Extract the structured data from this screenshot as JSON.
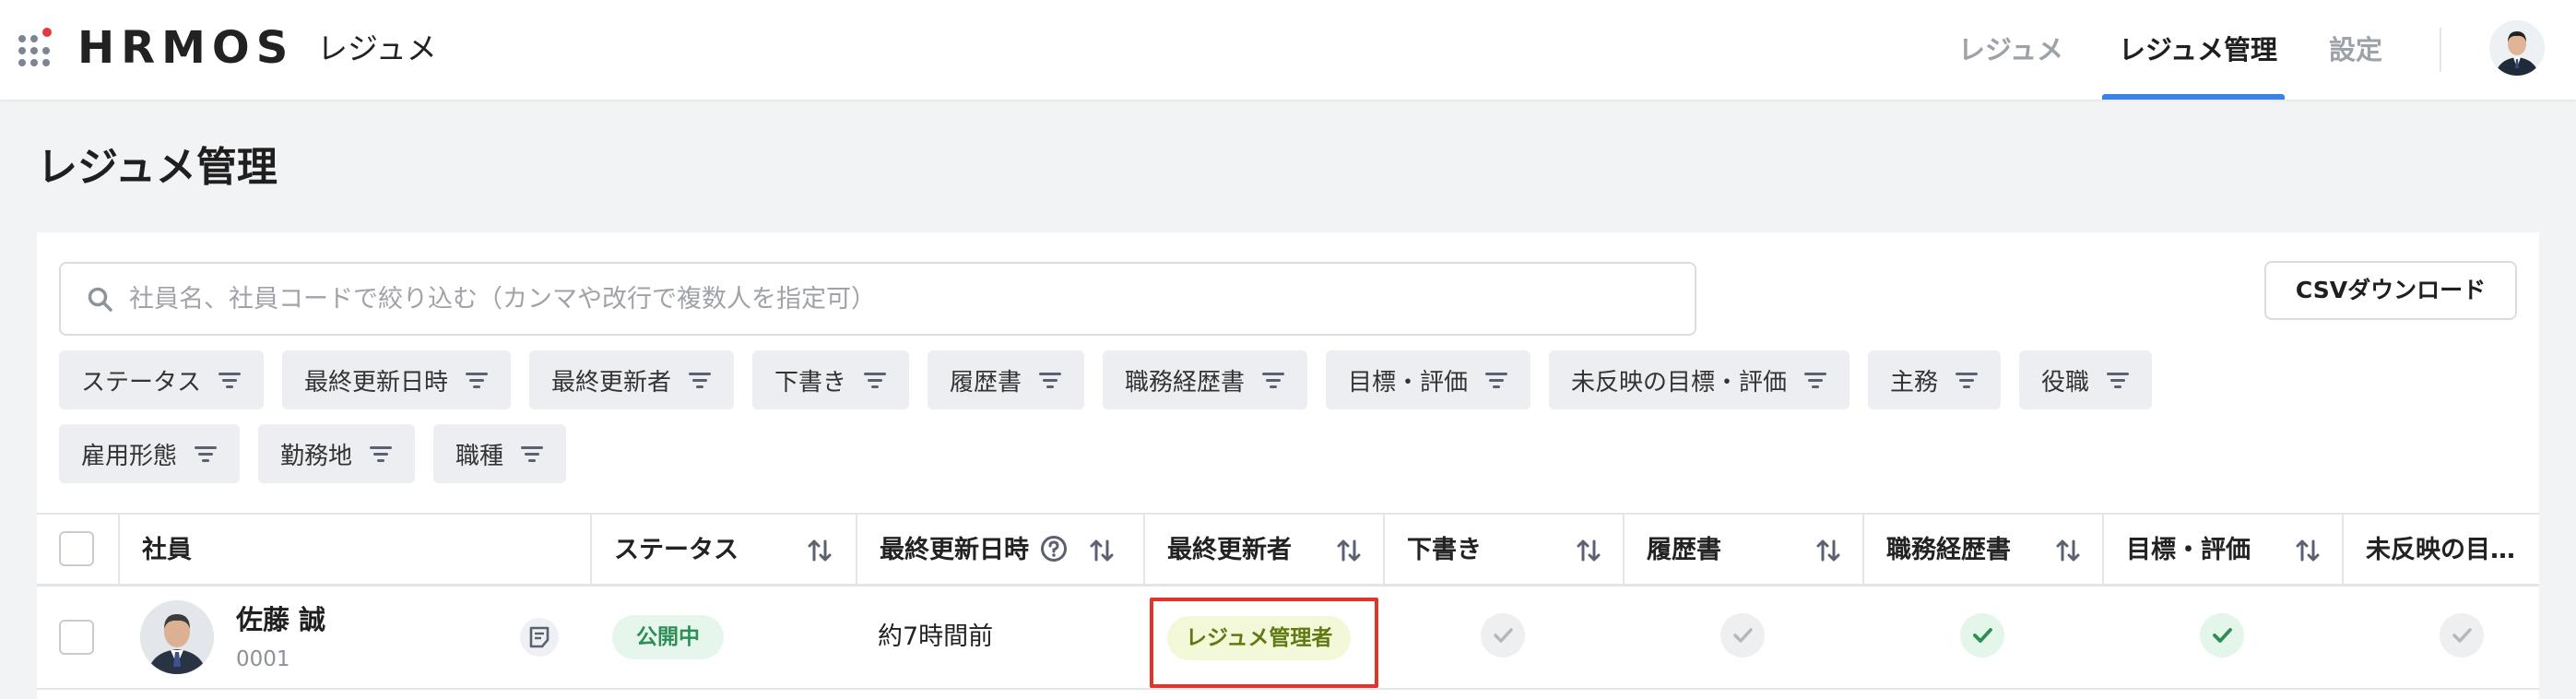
{
  "header": {
    "logo": "HRMOS",
    "product": "レジュメ",
    "nav": [
      {
        "label": "レジュメ",
        "active": false
      },
      {
        "label": "レジュメ管理",
        "active": true
      },
      {
        "label": "設定",
        "active": false
      }
    ]
  },
  "page": {
    "title": "レジュメ管理"
  },
  "search": {
    "placeholder": "社員名、社員コードで絞り込む（カンマや改行で複数人を指定可）"
  },
  "csv_button": "CSVダウンロード",
  "filters": [
    "ステータス",
    "最終更新日時",
    "最終更新者",
    "下書き",
    "履歴書",
    "職務経歴書",
    "目標・評価",
    "未反映の目標・評価",
    "主務",
    "役職",
    "雇用形態",
    "勤務地",
    "職種"
  ],
  "table": {
    "columns": [
      "社員",
      "ステータス",
      "最終更新日時",
      "最終更新者",
      "下書き",
      "履歴書",
      "職務経歴書",
      "目標・評価",
      "未反映の目…"
    ],
    "rows": [
      {
        "name": "佐藤 誠",
        "code": "0001",
        "status": "公開中",
        "updated": "約7時間前",
        "updated_by": "レジュメ管理者",
        "draft": "gray",
        "resume": "gray",
        "career": "green",
        "goal": "green",
        "unreflected": "gray"
      }
    ]
  },
  "colors": {
    "accent": "#3b82e8",
    "status_green": "#2d8f55",
    "highlight": "#e0352b"
  }
}
